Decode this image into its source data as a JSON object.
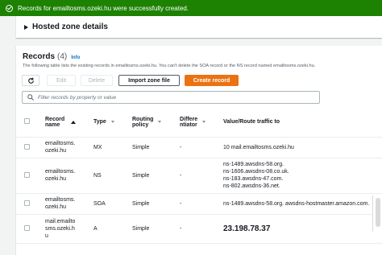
{
  "banner": {
    "message": "Records for emailtosms.ozeki.hu were successfully created."
  },
  "hosted_zone": {
    "title": "Hosted zone details"
  },
  "records": {
    "title": "Records",
    "count": "(4)",
    "info": "Info",
    "description": "The following table lists the existing records in emailtosms.ozeki.hu. You can't delete the SOA record or the NS record named emailtosms.ozeki.hu.",
    "buttons": {
      "edit": "Edit",
      "delete": "Delete",
      "import": "Import zone file",
      "create": "Create record"
    },
    "search_placeholder": "Filter records by property or value",
    "columns": {
      "name_l1": "Record",
      "name_l2": "name",
      "type": "Type",
      "routing_l1": "Routing",
      "routing_l2": "policy",
      "diff_l1": "Differe",
      "diff_l2": "ntiator",
      "value": "Value/Route traffic to"
    },
    "rows": [
      {
        "name": [
          "emailtosms.",
          "ozeki.hu"
        ],
        "type": "MX",
        "routing": "Simple",
        "diff": "-",
        "value": [
          "10 mail.emailtosms.ozeki.hu"
        ]
      },
      {
        "name": [
          "emailtosms.",
          "ozeki.hu"
        ],
        "type": "NS",
        "routing": "Simple",
        "diff": "-",
        "value": [
          "ns-1489.awsdns-58.org.",
          "ns-1606.awsdns-08.co.uk.",
          "ns-183.awsdns-47.com.",
          "ns-802.awsdns-36.net."
        ]
      },
      {
        "name": [
          "emailtosms.",
          "ozeki.hu"
        ],
        "type": "SOA",
        "routing": "Simple",
        "diff": "-",
        "value": [
          "ns-1489.awsdns-58.org. awsdns-hostmaster.amazon.com."
        ]
      },
      {
        "name": [
          "mail.emailto",
          "sms.ozeki.h",
          "u"
        ],
        "type": "A",
        "routing": "Simple",
        "diff": "-",
        "value": [
          "23.198.78.37"
        ]
      }
    ]
  }
}
